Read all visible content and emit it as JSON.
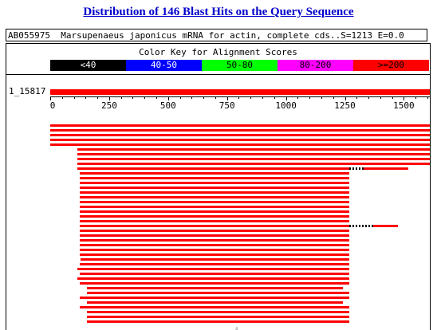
{
  "title": "Distribution of 146 Blast Hits on the Query Sequence",
  "description": "AB055975  Marsupenaeus japonicus mRNA for actin, complete cds..S=1213 E=0.0",
  "color_key": {
    "title": "Color Key for Alignment Scores",
    "segments": [
      {
        "label": "<40",
        "bg": "#000000",
        "fg": "#ffffff"
      },
      {
        "label": "40-50",
        "bg": "#0000ff",
        "fg": "#ffffff"
      },
      {
        "label": "50-80",
        "bg": "#00ff00",
        "fg": "#000000"
      },
      {
        "label": "80-200",
        "bg": "#ff00ff",
        "fg": "#000000"
      },
      {
        "label": ">=200",
        "bg": "#ff0000",
        "fg": "#000000"
      }
    ]
  },
  "query": {
    "label": "1_15817"
  },
  "axis": {
    "ticks": [
      "0",
      "250",
      "500",
      "750",
      "1000",
      "1250",
      "1500"
    ],
    "max": 1617
  },
  "hit_color": "#ff0000",
  "hits": [
    {
      "start": 0,
      "end": 1617
    },
    {
      "start": 0,
      "end": 1617
    },
    {
      "start": 0,
      "end": 1617
    },
    {
      "start": 0,
      "end": 1617
    },
    {
      "start": 0,
      "end": 1617
    },
    {
      "start": 115,
      "end": 1617
    },
    {
      "start": 115,
      "end": 1617
    },
    {
      "start": 115,
      "end": 1617
    },
    {
      "start": 115,
      "end": 1617
    },
    {
      "start": 115,
      "end": 1270,
      "extra_start": 1330,
      "extra_end": 1518
    },
    {
      "start": 125,
      "end": 1270
    },
    {
      "start": 125,
      "end": 1270
    },
    {
      "start": 125,
      "end": 1270
    },
    {
      "start": 125,
      "end": 1270
    },
    {
      "start": 125,
      "end": 1270
    },
    {
      "start": 125,
      "end": 1270
    },
    {
      "start": 125,
      "end": 1270
    },
    {
      "start": 125,
      "end": 1270
    },
    {
      "start": 125,
      "end": 1270
    },
    {
      "start": 125,
      "end": 1270
    },
    {
      "start": 125,
      "end": 1270
    },
    {
      "start": 125,
      "end": 1270,
      "extra_start": 1370,
      "extra_end": 1475
    },
    {
      "start": 125,
      "end": 1270
    },
    {
      "start": 125,
      "end": 1270
    },
    {
      "start": 125,
      "end": 1270
    },
    {
      "start": 125,
      "end": 1270
    },
    {
      "start": 125,
      "end": 1270
    },
    {
      "start": 125,
      "end": 1270
    },
    {
      "start": 130,
      "end": 1270
    },
    {
      "start": 125,
      "end": 1270
    },
    {
      "start": 115,
      "end": 1270
    },
    {
      "start": 125,
      "end": 1270
    },
    {
      "start": 115,
      "end": 1270
    },
    {
      "start": 125,
      "end": 1270
    },
    {
      "start": 155,
      "end": 1240
    },
    {
      "start": 155,
      "end": 1270
    },
    {
      "start": 125,
      "end": 1270
    },
    {
      "start": 155,
      "end": 1240
    },
    {
      "start": 125,
      "end": 1270
    },
    {
      "start": 155,
      "end": 1270
    },
    {
      "start": 155,
      "end": 1270
    },
    {
      "start": 155,
      "end": 1270
    }
  ]
}
